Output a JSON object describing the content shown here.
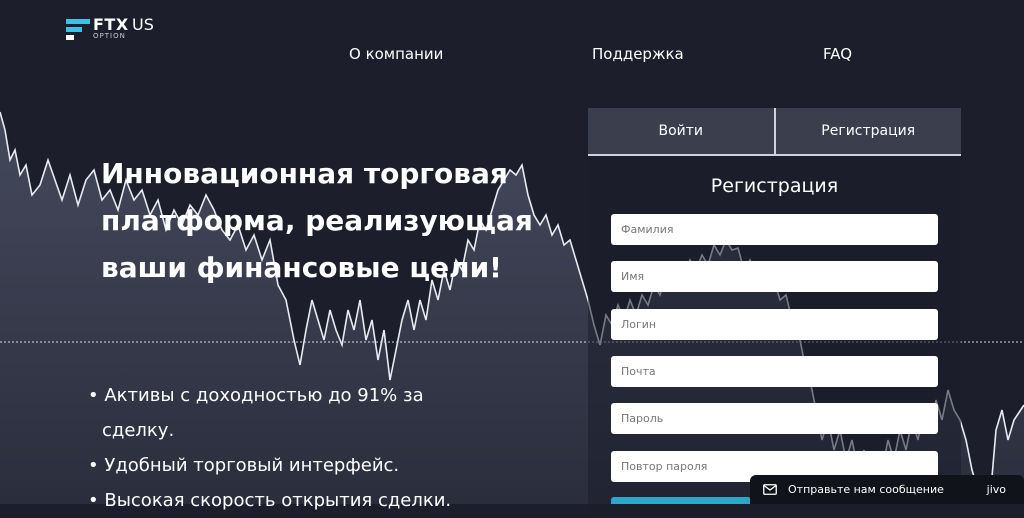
{
  "brand": {
    "name": "FTX",
    "region": "US",
    "subtitle": "OPTION"
  },
  "nav": {
    "items": [
      "О компании",
      "Поддержка",
      "FAQ"
    ]
  },
  "hero": {
    "title": "Инновационная торговая платформа, реализующая ваши финансовые цели!",
    "features": [
      "Активы с доходностью до 91% за сделку.",
      "Удобный торговый интерфейс.",
      "Высокая скорость открытия сделки."
    ]
  },
  "auth": {
    "login_tab": "Войти",
    "register_tab": "Регистрация",
    "form_title": "Регистрация",
    "fields": {
      "last_name": "Фамилия",
      "first_name": "Имя",
      "login": "Логин",
      "email": "Почта",
      "password": "Пароль",
      "password_repeat": "Повтор пароля"
    }
  },
  "chat": {
    "label": "Отправьте нам сообщение",
    "brand": "jivo"
  },
  "colors": {
    "background": "#1c1f2b",
    "panel": "#3a3e4d",
    "accent": "#2fa6c7",
    "logo_accent": "#3ec1e6"
  },
  "icons": {
    "chat": "envelope-icon",
    "logo": "ftx-logo-mark"
  }
}
